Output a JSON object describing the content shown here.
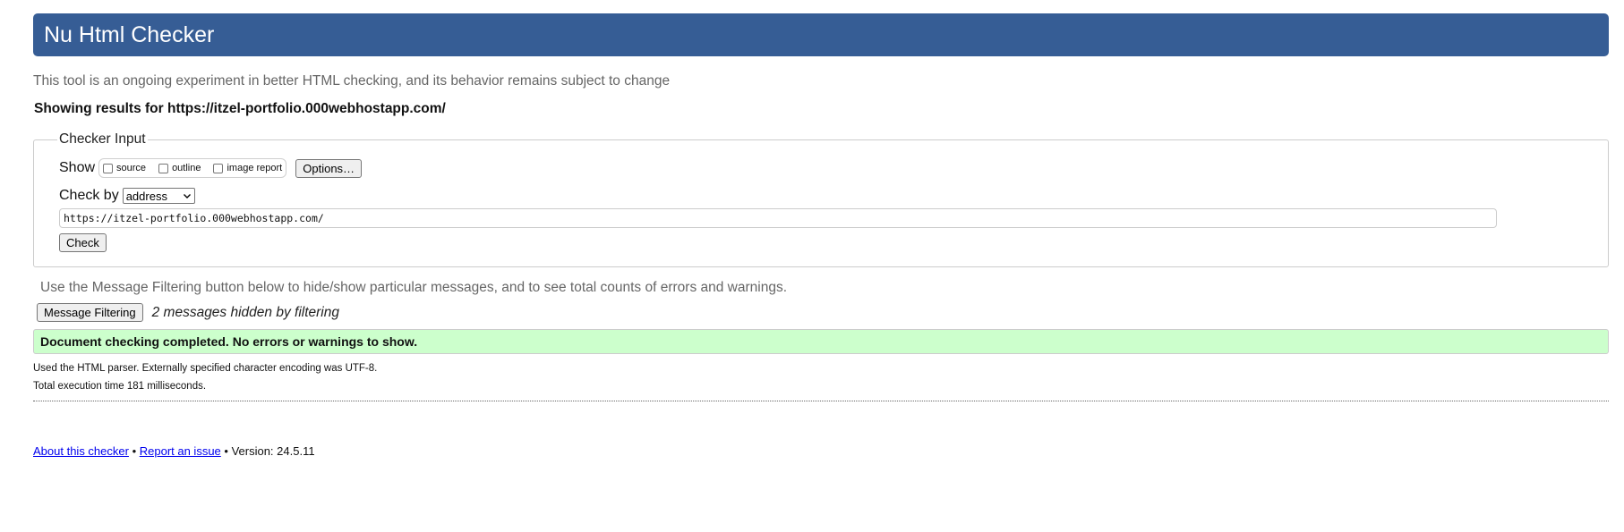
{
  "header": {
    "title": "Nu Html Checker"
  },
  "intro": "This tool is an ongoing experiment in better HTML checking, and its behavior remains subject to change",
  "showing": {
    "prefix": "Showing results for ",
    "url": "https://itzel-portfolio.000webhostapp.com/"
  },
  "checker_input": {
    "legend": "Checker Input",
    "show_label": "Show",
    "show_options": [
      {
        "label": "source",
        "checked": false
      },
      {
        "label": "outline",
        "checked": false
      },
      {
        "label": "image report",
        "checked": false
      }
    ],
    "options_button": "Options…",
    "check_by_label": "Check by",
    "check_by_value": "address",
    "url_value": "https://itzel-portfolio.000webhostapp.com/",
    "check_button": "Check"
  },
  "filtering": {
    "note": "Use the Message Filtering button below to hide/show particular messages, and to see total counts of errors and warnings.",
    "button": "Message Filtering",
    "hidden_note": "2 messages hidden by filtering"
  },
  "result": {
    "message": "Document checking completed. No errors or warnings to show.",
    "parser_note": "Used the HTML parser. Externally specified character encoding was UTF-8.",
    "time_note": "Total execution time 181 milliseconds."
  },
  "footer": {
    "about_link": "About this checker",
    "sep1": " • ",
    "report_link": "Report an issue",
    "version": " • Version: 24.5.11"
  },
  "colors": {
    "header_bg": "#365d95",
    "success_bg": "#ccffcc",
    "link": "#0000ee"
  }
}
